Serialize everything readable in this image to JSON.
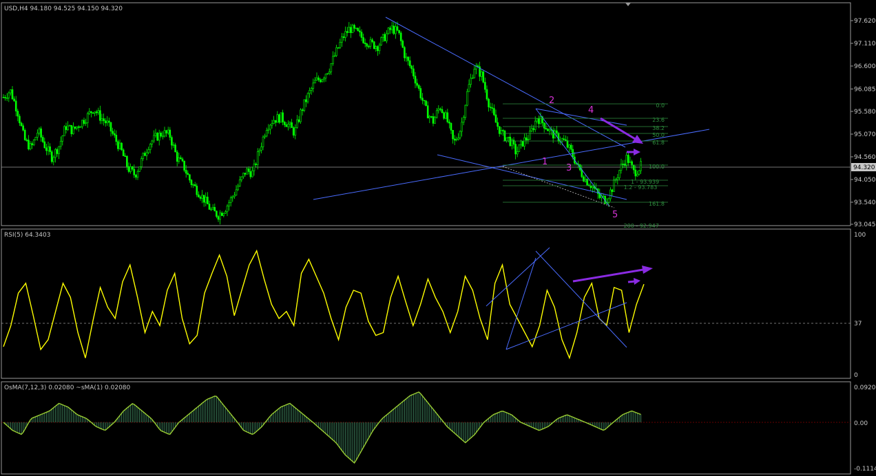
{
  "price_panel": {
    "header": "USD,H4  94.180 94.525 94.150 94.320",
    "current_price": "94.320",
    "y_labels": [
      "97.620",
      "97.110",
      "96.600",
      "96.085",
      "95.580",
      "95.070",
      "94.560",
      "94.050",
      "93.540",
      "93.045"
    ],
    "fib_levels": [
      "0.0",
      "23.6",
      "38.2",
      "50.0",
      "61.8",
      "100.0",
      "1 - 93.939",
      "1.2 - 93.783",
      "161.8",
      "200 - 92.947"
    ],
    "wave_labels": [
      "1",
      "2",
      "3",
      "4",
      "5"
    ],
    "colors": {
      "bull": "#00ff00",
      "line": "#4a6cff",
      "fib": "#2f8f3f",
      "wave": "#d633d6",
      "arrow": "#8a2be2"
    }
  },
  "rsi_panel": {
    "header": "RSI(5) 64.3403",
    "y_labels": [
      "100",
      "37",
      "0"
    ],
    "colors": {
      "line": "#ffff00",
      "trend": "#4a6cff",
      "arrow": "#8a2be2"
    }
  },
  "osma_panel": {
    "header": "OsMA(7,12,3) 0.02080  ~sMA(1) 0.02080",
    "y_labels": [
      "0.09207",
      "0.00",
      "-0.1114"
    ],
    "colors": {
      "hist": "#2f6f4f",
      "line": "#9acd32"
    }
  },
  "chart_data": [
    {
      "type": "candlestick",
      "title": "USD,H4  94.180 94.525 94.150 94.320",
      "ylim": [
        93.045,
        97.62
      ],
      "close_path": [
        95.9,
        96.05,
        95.6,
        94.95,
        94.75,
        95.15,
        94.8,
        94.55,
        94.8,
        95.25,
        95.15,
        95.3,
        95.45,
        95.65,
        95.45,
        95.3,
        95.0,
        94.7,
        94.3,
        94.15,
        94.5,
        94.85,
        95.0,
        95.1,
        95.05,
        94.55,
        94.35,
        94.0,
        93.8,
        93.6,
        93.35,
        93.25,
        93.4,
        93.65,
        93.95,
        94.25,
        94.2,
        94.75,
        95.25,
        95.4,
        95.45,
        95.3,
        95.1,
        95.6,
        95.95,
        96.25,
        96.35,
        96.55,
        96.9,
        97.25,
        97.45,
        97.35,
        97.2,
        97.1,
        97.05,
        97.25,
        97.45,
        97.35,
        96.8,
        96.5,
        96.05,
        95.6,
        95.35,
        95.7,
        95.4,
        94.85,
        95.2,
        96.05,
        96.6,
        96.4,
        95.8,
        95.35,
        95.05,
        94.95,
        94.65,
        94.9,
        95.05,
        95.45,
        95.3,
        95.1,
        95.0,
        94.9,
        94.65,
        94.3,
        94.05,
        93.9,
        93.65,
        93.6,
        93.9,
        94.3,
        94.55,
        94.2,
        94.35
      ]
    },
    {
      "type": "line",
      "title": "RSI(5) 64.3403",
      "ylim": [
        0,
        100
      ],
      "level": 37,
      "values": [
        20,
        35,
        58,
        65,
        42,
        18,
        25,
        45,
        65,
        55,
        30,
        12,
        38,
        62,
        48,
        40,
        66,
        78,
        55,
        30,
        45,
        35,
        60,
        72,
        40,
        22,
        28,
        58,
        72,
        85,
        70,
        42,
        60,
        78,
        88,
        68,
        50,
        40,
        45,
        35,
        72,
        82,
        70,
        58,
        40,
        25,
        48,
        60,
        58,
        38,
        28,
        30,
        55,
        70,
        52,
        35,
        50,
        68,
        55,
        45,
        30,
        45,
        70,
        60,
        40,
        25,
        65,
        78,
        50,
        40,
        30,
        20,
        35,
        60,
        48,
        25,
        12,
        30,
        55,
        65,
        40,
        35,
        62,
        60,
        30,
        50,
        64.34
      ]
    },
    {
      "type": "bar",
      "title": "OsMA(7,12,3) 0.02080  ~sMA(1) 0.02080",
      "ylim": [
        -0.1114,
        0.09207
      ],
      "values": [
        0.0,
        -0.02,
        -0.03,
        0.01,
        0.02,
        0.03,
        0.05,
        0.04,
        0.02,
        0.01,
        -0.01,
        -0.02,
        0.0,
        0.03,
        0.05,
        0.03,
        0.01,
        -0.02,
        -0.03,
        0.0,
        0.02,
        0.04,
        0.06,
        0.07,
        0.04,
        0.01,
        -0.02,
        -0.03,
        -0.01,
        0.02,
        0.04,
        0.05,
        0.03,
        0.01,
        -0.01,
        -0.03,
        -0.05,
        -0.08,
        -0.1,
        -0.06,
        -0.02,
        0.01,
        0.03,
        0.05,
        0.07,
        0.08,
        0.05,
        0.02,
        -0.01,
        -0.03,
        -0.05,
        -0.03,
        0.0,
        0.02,
        0.03,
        0.02,
        0.0,
        -0.01,
        -0.02,
        -0.01,
        0.01,
        0.02,
        0.01,
        0.0,
        -0.01,
        -0.02,
        0.0,
        0.02,
        0.03,
        0.0208
      ]
    }
  ]
}
